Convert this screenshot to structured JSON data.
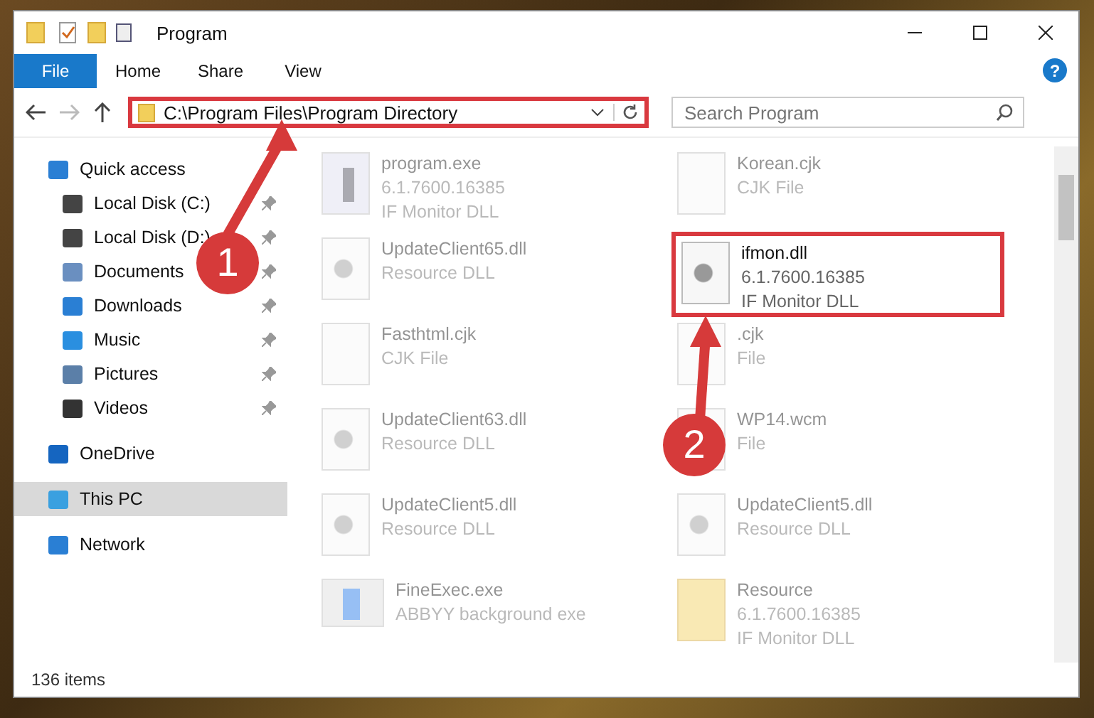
{
  "window": {
    "title": "Program"
  },
  "ribbon_tabs": [
    {
      "label": "File",
      "selected": true
    },
    {
      "label": "Home",
      "selected": false
    },
    {
      "label": "Share",
      "selected": false
    },
    {
      "label": "View",
      "selected": false
    }
  ],
  "help": {
    "label": "?"
  },
  "address_bar": {
    "path": "C:\\Program Files\\Program Directory",
    "highlighted": true
  },
  "search": {
    "placeholder": "Search Program"
  },
  "sidebar": {
    "items": [
      {
        "label": "Quick access",
        "selected": false,
        "children": [
          {
            "label": "Local Disk (C:)",
            "pinned": true,
            "selected": false
          },
          {
            "label": "Local Disk (D:)",
            "pinned": true,
            "selected": false
          },
          {
            "label": "Documents",
            "pinned": true,
            "selected": false
          },
          {
            "label": "Downloads",
            "pinned": true,
            "selected": false
          },
          {
            "label": "Music",
            "pinned": true,
            "selected": false
          },
          {
            "label": "Pictures",
            "pinned": true,
            "selected": false
          },
          {
            "label": "Videos",
            "pinned": true,
            "selected": false
          }
        ]
      },
      {
        "label": "OneDrive",
        "selected": false
      },
      {
        "label": "This PC",
        "selected": true
      },
      {
        "label": "Network",
        "selected": false
      }
    ]
  },
  "files": [
    {
      "name": "program.exe",
      "details": [
        "6.1.7600.16385",
        "IF Monitor DLL"
      ],
      "kind": "exe",
      "highlighted": false
    },
    {
      "name": "Korean.cjk",
      "details": [
        "CJK File"
      ],
      "kind": "blank",
      "highlighted": false
    },
    {
      "name": "UpdateClient65.dll",
      "details": [
        "Resource DLL"
      ],
      "kind": "dll",
      "highlighted": false
    },
    {
      "name": "ifmon.dll",
      "details": [
        "6.1.7600.16385",
        "IF Monitor DLL"
      ],
      "kind": "gear",
      "highlighted": true
    },
    {
      "name": "Fasthtml.cjk",
      "details": [
        "CJK File"
      ],
      "kind": "blank",
      "highlighted": false
    },
    {
      "name": ".cjk",
      "details": [
        "File"
      ],
      "kind": "blank",
      "highlighted": false
    },
    {
      "name": "UpdateClient63.dll",
      "details": [
        "Resource DLL"
      ],
      "kind": "dll",
      "highlighted": false
    },
    {
      "name": "WP14.wcm",
      "details": [
        "File"
      ],
      "kind": "blank",
      "highlighted": false
    },
    {
      "name": "UpdateClient5.dll",
      "details": [
        "Resource DLL"
      ],
      "kind": "dll",
      "highlighted": false
    },
    {
      "name": "UpdateClient5.dll",
      "details": [
        "Resource DLL"
      ],
      "kind": "dll",
      "highlighted": false
    },
    {
      "name": "FineExec.exe",
      "details": [
        "ABBYY background exe"
      ],
      "kind": "app",
      "highlighted": false
    },
    {
      "name": "Resource",
      "details": [
        "6.1.7600.16385",
        "IF Monitor DLL"
      ],
      "kind": "folder",
      "highlighted": false
    }
  ],
  "status_bar": {
    "item_count": "136 items"
  },
  "callouts": [
    {
      "label": "1"
    },
    {
      "label": "2"
    }
  ]
}
